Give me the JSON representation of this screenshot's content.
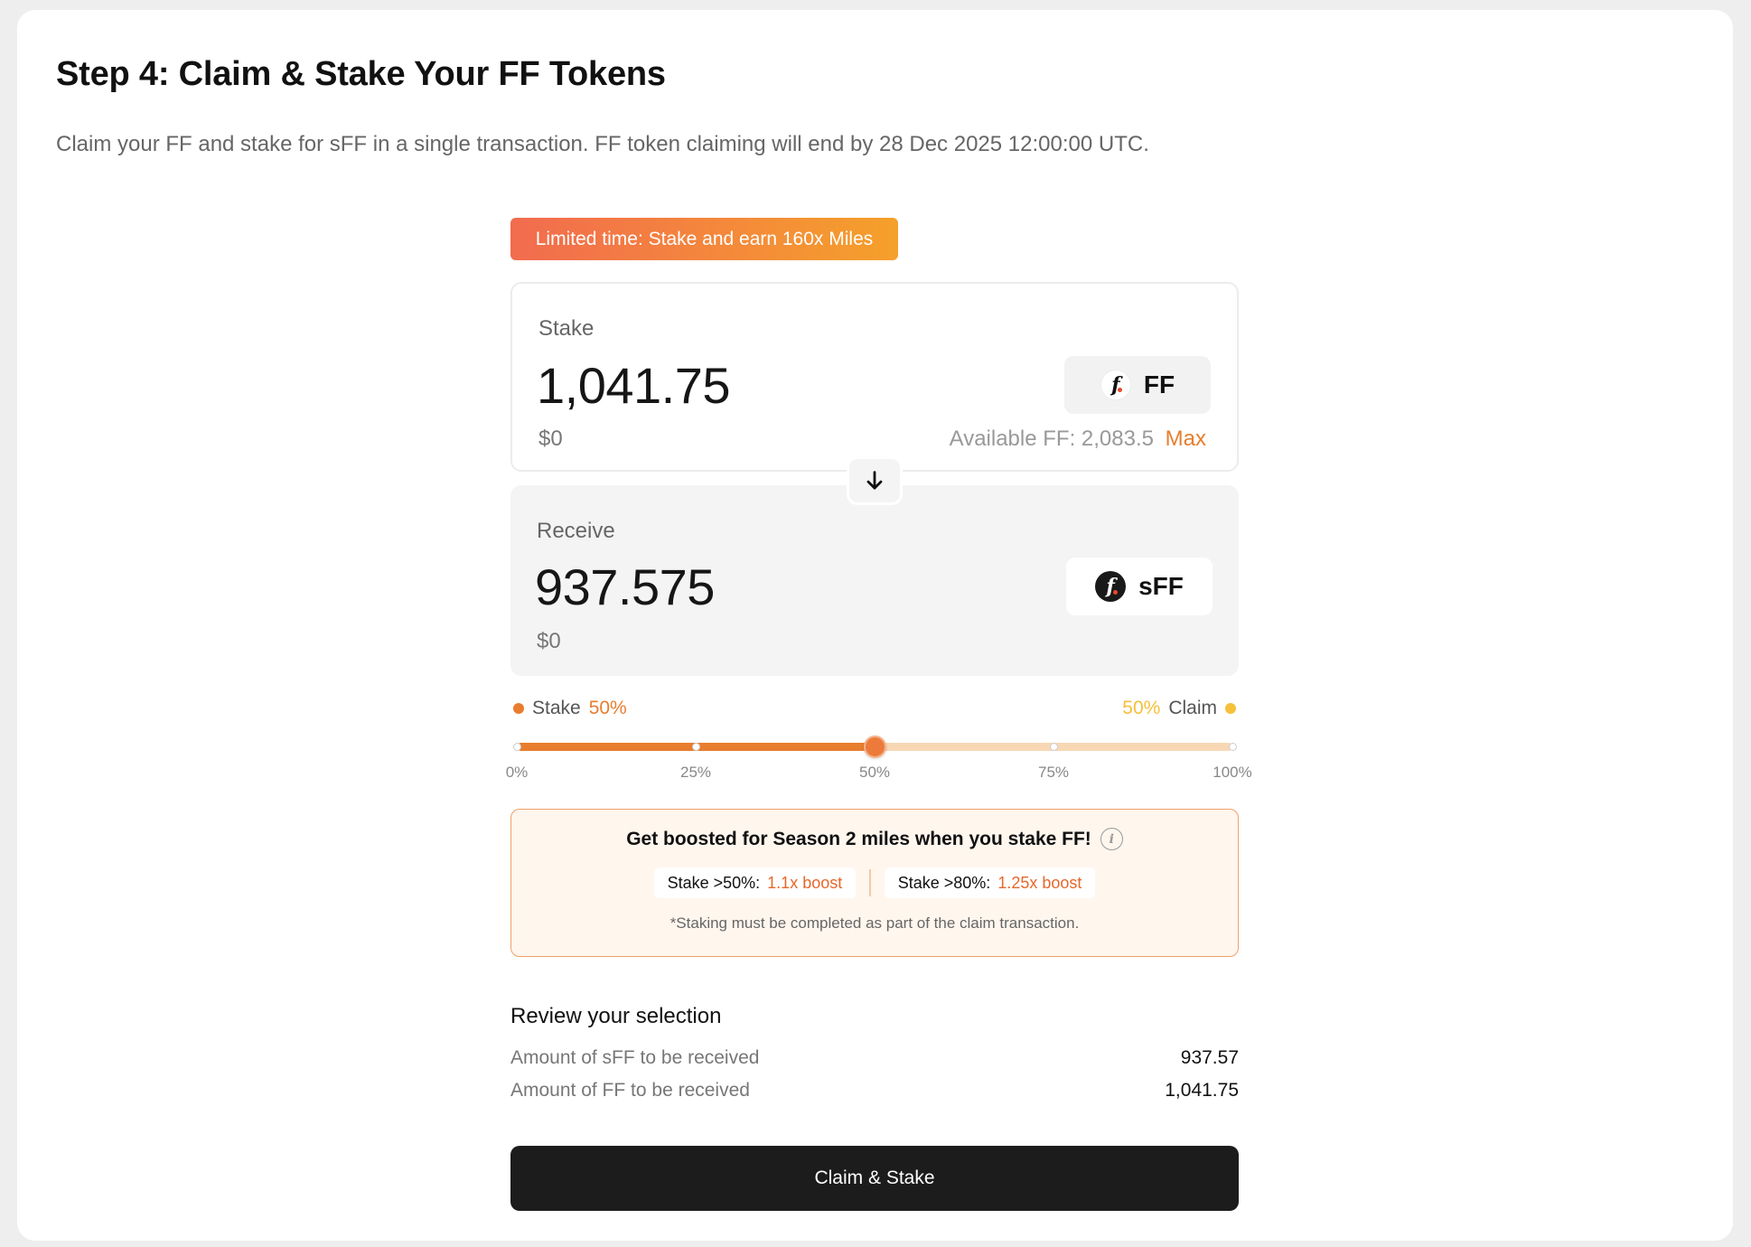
{
  "page": {
    "title": "Step 4: Claim & Stake Your FF Tokens",
    "subtitle": "Claim your FF and stake for sFF in a single transaction. FF token claiming will end by 28 Dec 2025 12:00:00 UTC."
  },
  "promo": {
    "label": "Limited time: Stake and earn 160x Miles"
  },
  "stake": {
    "label": "Stake",
    "amount": "1,041.75",
    "usd": "$0",
    "token": "FF",
    "token_icon": "ff-token-icon",
    "available_label": "Available FF: 2,083.5",
    "max_label": "Max"
  },
  "swap_icon": "arrow-down-icon",
  "receive": {
    "label": "Receive",
    "amount": "937.575",
    "usd": "$0",
    "token": "sFF",
    "token_icon": "sff-token-icon"
  },
  "split": {
    "stake_label": "Stake",
    "stake_pct": "50%",
    "claim_label": "Claim",
    "claim_pct": "50%",
    "value_percent": 50,
    "ticks": [
      "0%",
      "25%",
      "50%",
      "75%",
      "100%"
    ]
  },
  "boost": {
    "title": "Get boosted for Season 2 miles when you stake FF!",
    "chips": [
      {
        "label": "Stake >50%:",
        "value": "1.1x boost"
      },
      {
        "label": "Stake >80%:",
        "value": "1.25x boost"
      }
    ],
    "note": "*Staking must be completed as part of the claim transaction."
  },
  "review": {
    "title": "Review your selection",
    "rows": [
      {
        "label": "Amount of sFF to be received",
        "value": "937.57"
      },
      {
        "label": "Amount of FF to be received",
        "value": "1,041.75"
      }
    ]
  },
  "cta": {
    "label": "Claim & Stake"
  },
  "colors": {
    "accent": "#e87d2e",
    "claim": "#f5c03a",
    "cta_bg": "#1c1c1c",
    "promo_start": "#f26b4f",
    "promo_end": "#f5a02b"
  }
}
